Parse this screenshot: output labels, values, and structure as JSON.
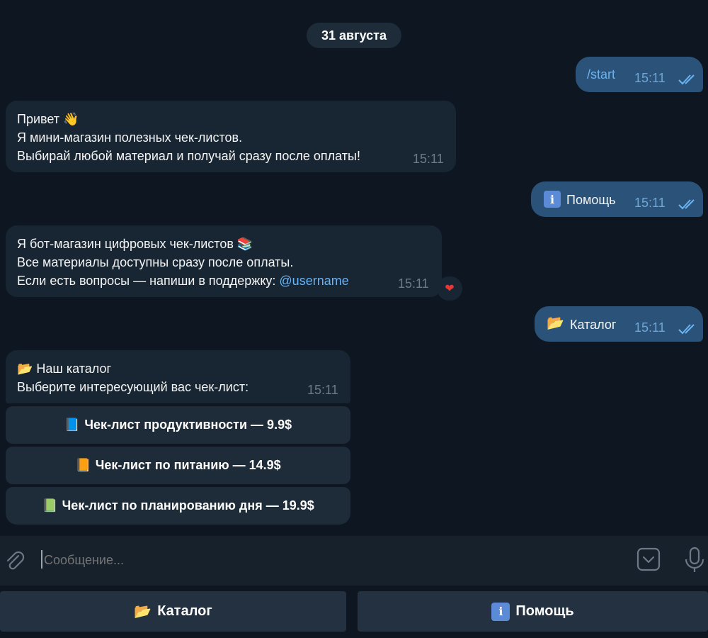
{
  "date_label": "31 августа",
  "messages": {
    "start": {
      "text": "/start",
      "time": "15:11"
    },
    "welcome": {
      "lines": [
        "Привет 👋",
        "Я мини-магазин полезных чек-листов.",
        "Выбирай любой материал и получай сразу после оплаты!"
      ],
      "time": "15:11"
    },
    "help_cmd": {
      "icon": "i",
      "text": "Помощь",
      "time": "15:11"
    },
    "about": {
      "line1": "Я бот-магазин цифровых чек-листов 📚",
      "line2": "Все материалы доступны сразу после оплаты.",
      "line3_prefix": "Если есть вопросы — напиши в поддержку: ",
      "line3_link": "@username",
      "time": "15:11",
      "reaction": "❤"
    },
    "catalog_cmd": {
      "icon": "📂",
      "text": "Каталог",
      "time": "15:11"
    },
    "catalog": {
      "title": "📂 Наш каталог",
      "subtitle": "Выберите интересующий вас чек-лист:",
      "time": "15:11",
      "buttons": [
        {
          "emoji": "📘",
          "label": "Чек-лист продуктивности — 9.9$",
          "color": "#3a78c9"
        },
        {
          "emoji": "📙",
          "label": "Чек-лист по питанию — 14.9$",
          "color": "#e08a1e"
        },
        {
          "emoji": "📗",
          "label": "Чек-лист по планированию дня — 19.9$",
          "color": "#5aa53c"
        }
      ]
    }
  },
  "composer": {
    "placeholder": "Сообщение..."
  },
  "reply_keyboard": {
    "catalog": {
      "icon": "📂",
      "label": "Каталог"
    },
    "help": {
      "icon": "i",
      "label": "Помощь"
    }
  },
  "colors": {
    "bg": "#0e1621",
    "incoming": "#182533",
    "outgoing": "#2b5278",
    "link": "#6ab3f3"
  }
}
